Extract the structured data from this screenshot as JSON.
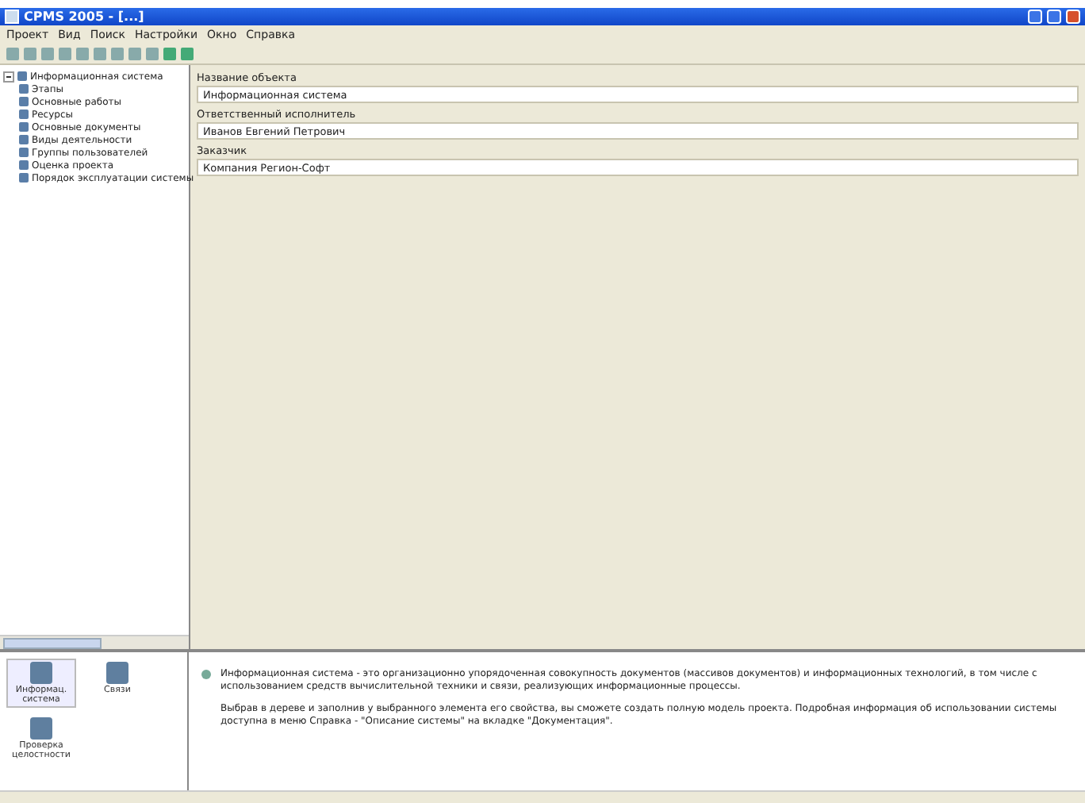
{
  "window": {
    "title": "СРМS 2005 - [...]"
  },
  "menu": [
    "Проект",
    "Вид",
    "Поиск",
    "Настройки",
    "Окно",
    "Справка"
  ],
  "tree": {
    "label": "Информационная система",
    "expanded": true,
    "children": [
      {
        "label": "Этапы"
      },
      {
        "label": "Основные работы"
      },
      {
        "label": "Ресурсы"
      },
      {
        "label": "Основные документы"
      },
      {
        "label": "Виды деятельности"
      },
      {
        "label": "Группы пользователей"
      },
      {
        "label": "Оценка проекта"
      },
      {
        "label": "Порядок эксплуатации системы"
      }
    ]
  },
  "fields": [
    {
      "label": "Название объекта",
      "value": "Информационная система"
    },
    {
      "label": "Ответственный исполнитель",
      "value": "Иванов Евгений Петрович"
    },
    {
      "label": "Заказчик",
      "value": "Компания Регион-Софт"
    }
  ],
  "shortcuts": [
    {
      "label": "Информац. система",
      "selected": true
    },
    {
      "label": "Связи",
      "selected": false
    },
    {
      "label": "Проверка целостности",
      "selected": false
    }
  ],
  "description": [
    "Информационная система - это организационно упорядоченная совокупность документов (массивов документов) и информационных технологий, в том числе с использованием средств вычислительной техники и связи, реализующих информационные процессы.",
    "Выбрав в дереве и заполнив у выбранного элемента его свойства, вы сможете создать полную модель проекта. Подробная информация об использовании системы доступна в меню Справка - \"Описание системы\" на вкладке \"Документация\"."
  ]
}
